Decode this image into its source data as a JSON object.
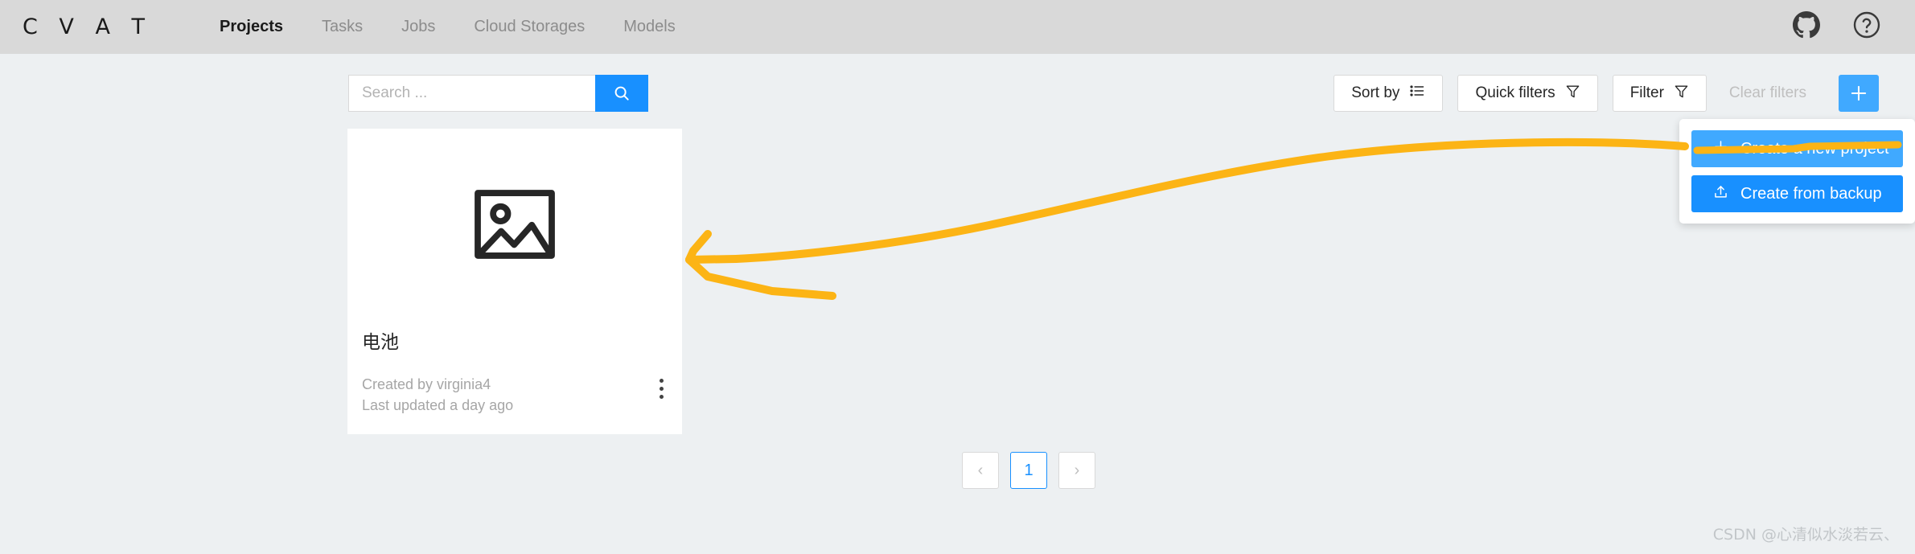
{
  "header": {
    "logo": "C V A T",
    "nav": [
      {
        "label": "Projects",
        "active": true
      },
      {
        "label": "Tasks",
        "active": false
      },
      {
        "label": "Jobs",
        "active": false
      },
      {
        "label": "Cloud Storages",
        "active": false
      },
      {
        "label": "Models",
        "active": false
      }
    ],
    "icons": [
      {
        "name": "github-icon",
        "title": "GitHub"
      },
      {
        "name": "help-icon",
        "title": "Help"
      }
    ],
    "background_color": "#d9d9d9"
  },
  "toolbar": {
    "search": {
      "value": "",
      "placeholder": "Search ...",
      "button_icon": "search-icon"
    },
    "sort_by_label": "Sort by",
    "sort_by_icon": "list-icon",
    "quick_filters_label": "Quick filters",
    "quick_filters_icon": "funnel-icon",
    "filter_label": "Filter",
    "filter_icon": "funnel-icon",
    "clear_filters_label": "Clear filters",
    "clear_filters_disabled": true,
    "plus_button_icon": "plus-icon",
    "accent_color": "#1890ff",
    "accent_hover_color": "#40a9ff"
  },
  "create_menu": {
    "visible": true,
    "items": [
      {
        "label": "Create a new project",
        "icon": "plus-icon",
        "state": "hovered"
      },
      {
        "label": "Create from backup",
        "icon": "upload-icon",
        "state": "normal"
      }
    ]
  },
  "project_card": {
    "preview_icon": "image-placeholder-icon",
    "title": "电池",
    "created_by": "Created by virginia4",
    "last_updated": "Last updated a day ago",
    "menu_icon": "more-vertical-icon"
  },
  "pagination": {
    "prev_label": "‹",
    "next_label": "›",
    "pages": [
      "1"
    ],
    "current_page": "1"
  },
  "annotation": {
    "color": "#fcb415",
    "description": "hand-drawn arrow pointing from Create a new project menu item leftward"
  },
  "watermark": "CSDN @心清似水淡若云、",
  "page_background_color": "#edf0f2"
}
